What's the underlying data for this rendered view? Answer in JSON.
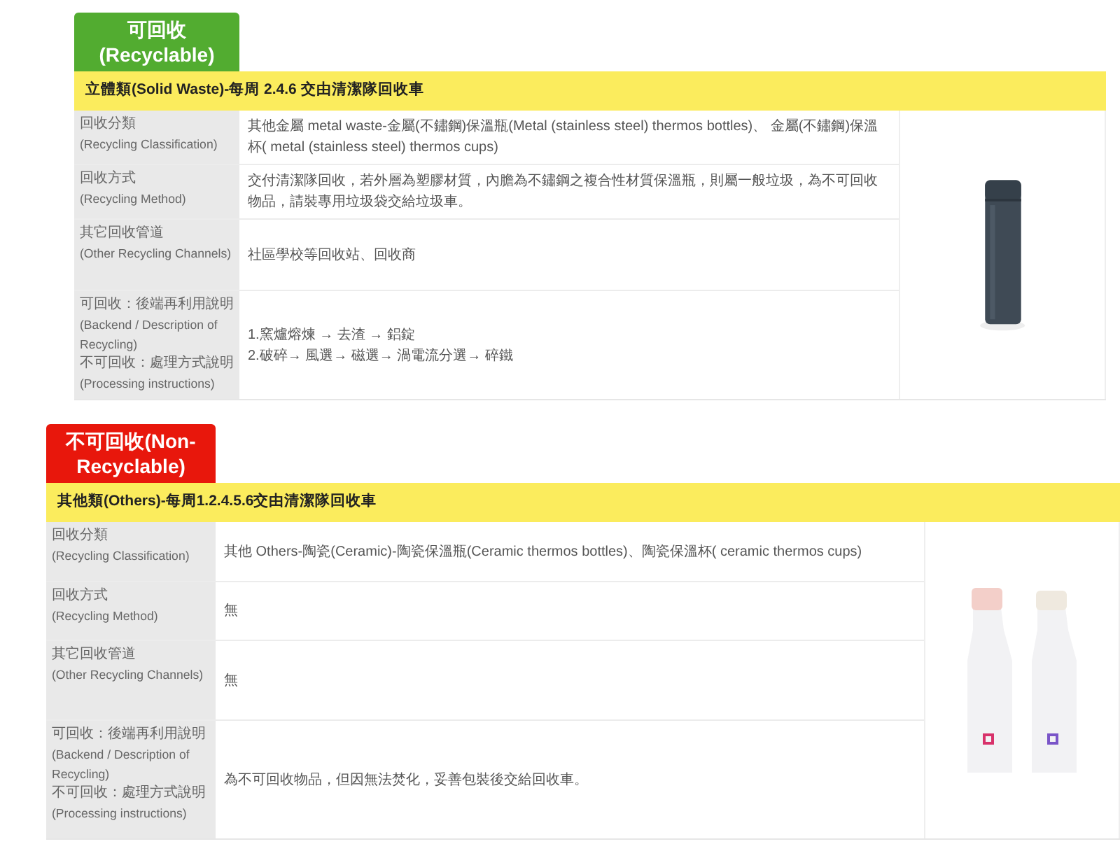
{
  "sections": [
    {
      "kind": "recyclable",
      "badge": [
        "可回收",
        "(Recyclable)"
      ],
      "heading": "立體類(Solid Waste)-每周 2.4.6 交由清潔隊回收車",
      "rows": [
        {
          "label": [
            "回收分類",
            "(Recycling Classification)"
          ],
          "value": [
            "其他金屬 metal waste-金屬(不鏽鋼)保溫瓶(Metal (stainless steel) thermos bottles)、 金屬(不鏽鋼)保溫杯( metal (stainless steel) thermos cups)"
          ]
        },
        {
          "label": [
            "回收方式",
            "(Recycling Method)"
          ],
          "value": [
            "交付清潔隊回收，若外層為塑膠材質，內膽為不鏽鋼之複合性材質保溫瓶，則屬一般垃圾，為不可回收物品，請裝專用垃圾袋交給垃圾車。"
          ]
        },
        {
          "label": [
            "其它回收管道",
            "(Other Recycling Channels)"
          ],
          "value": [
            "社區學校等回收站、回收商"
          ]
        },
        {
          "label": [
            "可回收：後端再利用說明",
            "(Backend / Description of Recycling)",
            "不可回收：處理方式說明",
            "(Processing instructions)"
          ],
          "value": [
            "1.窯爐熔煉 → 去渣 → 鋁錠",
            "2.破碎→ 風選→ 磁選→ 渦電流分選→ 碎鐵"
          ]
        }
      ]
    },
    {
      "kind": "non_recyclable",
      "badge": [
        "不可回收(Non-Recyclable)"
      ],
      "heading": "其他類(Others)-每周1.2.4.5.6交由清潔隊回收車",
      "rows": [
        {
          "label": [
            "回收分類",
            "(Recycling Classification)"
          ],
          "value": [
            "其他 Others-陶瓷(Ceramic)-陶瓷保溫瓶(Ceramic thermos bottles)、陶瓷保溫杯( ceramic thermos cups)"
          ]
        },
        {
          "label": [
            "回收方式",
            "(Recycling Method)"
          ],
          "value": [
            "無"
          ]
        },
        {
          "label": [
            "其它回收管道",
            "(Other Recycling Channels)"
          ],
          "value": [
            "無"
          ]
        },
        {
          "label": [
            "可回收：後端再利用說明",
            "(Backend / Description of Recycling)",
            "不可回收：處理方式說明",
            "(Processing instructions)"
          ],
          "value": [
            "為不可回收物品，但因無法焚化，妥善包裝後交給回收車。"
          ]
        }
      ]
    }
  ]
}
